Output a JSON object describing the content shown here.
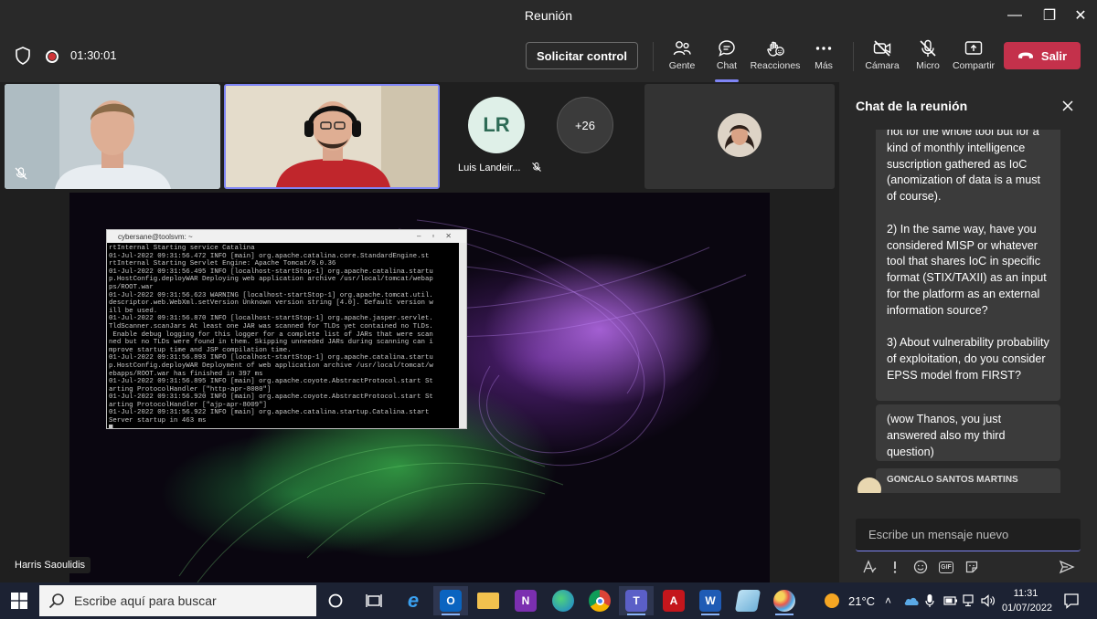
{
  "window": {
    "title": "Reunión",
    "minimize": "—",
    "maximize": "❐",
    "close": "✕"
  },
  "toolbar": {
    "timer": "01:30:01",
    "request_control": "Solicitar control",
    "people": "Gente",
    "chat": "Chat",
    "reactions": "Reacciones",
    "more": "Más",
    "camera": "Cámara",
    "mic": "Micro",
    "share": "Compartir",
    "leave": "Salir"
  },
  "participants": {
    "lr_initials": "LR",
    "lr_name": "Luis Landeir...",
    "more_count": "+26",
    "presenter_caption": "Harris Saoulidis"
  },
  "terminal": {
    "title": "cybersane@toolsvm: ~",
    "lines": [
      "rtInternal Starting service Catalina",
      "01-Jul-2022 09:31:56.472 INFO [main] org.apache.catalina.core.StandardEngine.st",
      "rtInternal Starting Servlet Engine: Apache Tomcat/8.0.36",
      "01-Jul-2022 09:31:56.495 INFO [localhost-startStop-1] org.apache.catalina.startu",
      "p.HostConfig.deployWAR Deploying web application archive /usr/local/tomcat/webap",
      "ps/ROOT.war",
      "01-Jul-2022 09:31:56.623 WARNING [localhost-startStop-1] org.apache.tomcat.util.",
      "descriptor.web.WebXml.setVersion Unknown version string [4.0]. Default version w",
      "ill be used.",
      "01-Jul-2022 09:31:56.870 INFO [localhost-startStop-1] org.apache.jasper.servlet.",
      "TldScanner.scanJars At least one JAR was scanned for TLDs yet contained no TLDs.",
      " Enable debug logging for this logger for a complete list of JARs that were scan",
      "ned but no TLDs were found in them. Skipping unneeded JARs during scanning can i",
      "mprove startup time and JSP compilation time.",
      "01-Jul-2022 09:31:56.893 INFO [localhost-startStop-1] org.apache.catalina.startu",
      "p.HostConfig.deployWAR Deployment of web application archive /usr/local/tomcat/w",
      "ebapps/ROOT.war has finished in 397 ms",
      "01-Jul-2022 09:31:56.895 INFO [main] org.apache.coyote.AbstractProtocol.start St",
      "arting ProtocolHandler [\"http-apr-8080\"]",
      "01-Jul-2022 09:31:56.920 INFO [main] org.apache.coyote.AbstractProtocol.start St",
      "arting ProtocolHandler [\"ajp-apr-8009\"]",
      "01-Jul-2022 09:31:56.922 INFO [main] org.apache.catalina.startup.Catalina.start",
      "Server startup in 463 ms",
      "█"
    ]
  },
  "chat": {
    "title": "Chat de la reunión",
    "messages": [
      {
        "paragraphs": [
          "not for the whole tool but for a kind of monthly intelligence suscription gathered as IoC (anomization of data is a must of course).",
          "2) In the same way, have you considered MISP or whatever tool that shares IoC in specific format (STIX/TAXII) as an input for the platform as an external information source?",
          "3) About vulnerability probability of exploitation, do you consider EPSS model from FIRST?"
        ]
      },
      {
        "paragraphs": [
          "(wow Thanos, you just answered also my third question)"
        ]
      }
    ],
    "next_author": "GONCALO SANTOS MARTINS",
    "compose_placeholder": "Escribe un mensaje nuevo",
    "gif_label": "GIF"
  },
  "taskbar": {
    "search_placeholder": "Escribe aquí para buscar",
    "weather": "21°C",
    "time": "11:31",
    "date": "01/07/2022"
  },
  "colors": {
    "accent": "#7f85f5",
    "leave": "#c4314b",
    "panel": "#292929"
  }
}
